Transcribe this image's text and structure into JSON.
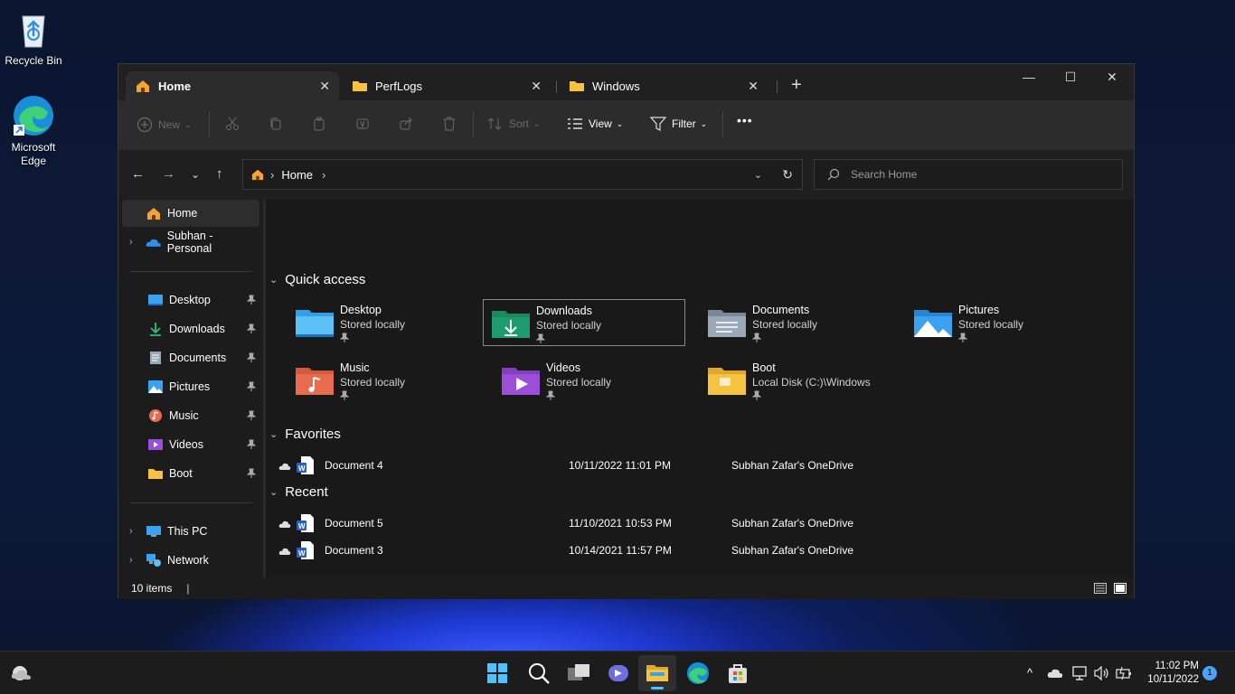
{
  "desktop": {
    "icons": [
      {
        "label": "Recycle Bin",
        "icon": "recycle-bin-icon"
      },
      {
        "label": "Microsoft Edge",
        "icon": "edge-icon"
      }
    ]
  },
  "window": {
    "tabs": [
      {
        "label": "Home",
        "icon": "home-icon",
        "active": true
      },
      {
        "label": "PerfLogs",
        "icon": "folder-icon",
        "active": false
      },
      {
        "label": "Windows",
        "icon": "folder-icon",
        "active": false
      }
    ],
    "toolbar": {
      "new_label": "New",
      "sort_label": "Sort",
      "view_label": "View",
      "filter_label": "Filter",
      "more_label": "•••"
    },
    "address": {
      "crumb": "Home"
    },
    "search": {
      "placeholder": "Search Home"
    },
    "sidebar": {
      "home": "Home",
      "onedrive": "Subhan - Personal",
      "pinned": [
        {
          "label": "Desktop",
          "icon": "desktop-folder-icon"
        },
        {
          "label": "Downloads",
          "icon": "downloads-icon"
        },
        {
          "label": "Documents",
          "icon": "documents-icon"
        },
        {
          "label": "Pictures",
          "icon": "pictures-icon"
        },
        {
          "label": "Music",
          "icon": "music-icon"
        },
        {
          "label": "Videos",
          "icon": "videos-icon"
        },
        {
          "label": "Boot",
          "icon": "folder-icon"
        }
      ],
      "this_pc": "This PC",
      "network": "Network"
    },
    "quick_access": {
      "title": "Quick access",
      "items": [
        {
          "name": "Desktop",
          "sub": "Stored locally",
          "color": "#2f9fe8"
        },
        {
          "name": "Downloads",
          "sub": "Stored locally",
          "color": "#1f9c6e"
        },
        {
          "name": "Documents",
          "sub": "Stored locally",
          "color": "#8c9aab"
        },
        {
          "name": "Pictures",
          "sub": "Stored locally",
          "color": "#3aa3f0"
        },
        {
          "name": "Music",
          "sub": "Stored locally",
          "color": "#e86b4f"
        },
        {
          "name": "Videos",
          "sub": "Stored locally",
          "color": "#9b4fd9"
        },
        {
          "name": "Boot",
          "sub": "Local Disk (C:)\\Windows",
          "color": "#f5c242"
        }
      ]
    },
    "favorites": {
      "title": "Favorites",
      "files": [
        {
          "name": "Document 4",
          "date": "10/11/2022 11:01 PM",
          "location": "Subhan Zafar's OneDrive"
        }
      ]
    },
    "recent": {
      "title": "Recent",
      "files": [
        {
          "name": "Document 5",
          "date": "11/10/2021 10:53 PM",
          "location": "Subhan Zafar's OneDrive"
        },
        {
          "name": "Document 3",
          "date": "10/14/2021 11:57 PM",
          "location": "Subhan Zafar's OneDrive"
        }
      ]
    },
    "status": {
      "count": "10 items"
    }
  },
  "taskbar": {
    "time": "11:02 PM",
    "date": "10/11/2022",
    "notifications": "1"
  }
}
